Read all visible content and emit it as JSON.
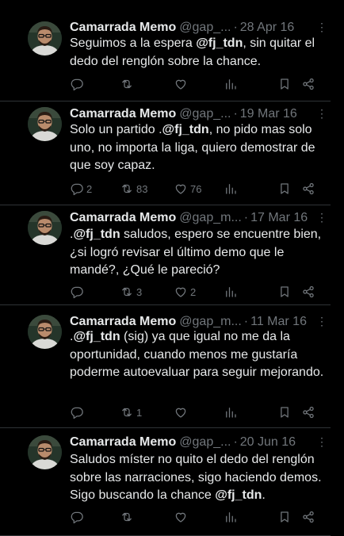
{
  "tweets": [
    {
      "name": "Camarrada Memo",
      "handle": "@gap_...",
      "separator": "·",
      "date": "28 Apr 16",
      "more": "⋮",
      "text_before": "Seguimos a la espera ",
      "mention": "@fj_tdn",
      "text_after": ", sin quitar el dedo del renglón sobre la chance.",
      "replies": "",
      "retweets": "",
      "likes": ""
    },
    {
      "name": "Camarrada Memo",
      "handle": "@gap_...",
      "separator": "·",
      "date": "19 Mar 16",
      "more": "⋮",
      "text_before": "Solo un partido .",
      "mention": "@fj_tdn",
      "text_after": ", no pido mas solo uno, no importa la liga, quiero demostrar de que soy capaz.",
      "replies": "2",
      "retweets": "83",
      "likes": "76"
    },
    {
      "name": "Camarrada Memo",
      "handle": "@gap_m...",
      "separator": "·",
      "date": "17 Mar 16",
      "more": "⋮",
      "text_before": ".",
      "mention": "@fj_tdn",
      "text_after": " saludos, espero se encuentre bien, ¿si logró revisar el último demo que le mandé?, ¿Qué le pareció?",
      "replies": "",
      "retweets": "3",
      "likes": "2"
    },
    {
      "name": "Camarrada Memo",
      "handle": "@gap_m...",
      "separator": "·",
      "date": "11 Mar 16",
      "more": "⋮",
      "text_before": ".",
      "mention": "@fj_tdn",
      "text_after": " (sig) ya que igual no me da la oportunidad, cuando menos me gustaría poderme autoevaluar para seguir mejorando.",
      "replies": "",
      "retweets": "1",
      "likes": ""
    },
    {
      "name": "Camarrada Memo",
      "handle": "@gap_...",
      "separator": "·",
      "date": "20 Jun 16",
      "more": "⋮",
      "text_before": "Saludos míster no quito el dedo del renglón sobre las narraciones, sigo haciendo demos. Sigo buscando la chance ",
      "mention": "@fj_tdn",
      "text_after": ".",
      "replies": "",
      "retweets": "",
      "likes": ""
    }
  ],
  "colors": {
    "background": "#000000",
    "text": "#e7e9ea",
    "secondary": "#71767b",
    "divider": "#2f3336"
  },
  "icons": [
    "reply-icon",
    "retweet-icon",
    "like-icon",
    "views-icon",
    "bookmark-icon",
    "share-icon",
    "more-icon"
  ]
}
